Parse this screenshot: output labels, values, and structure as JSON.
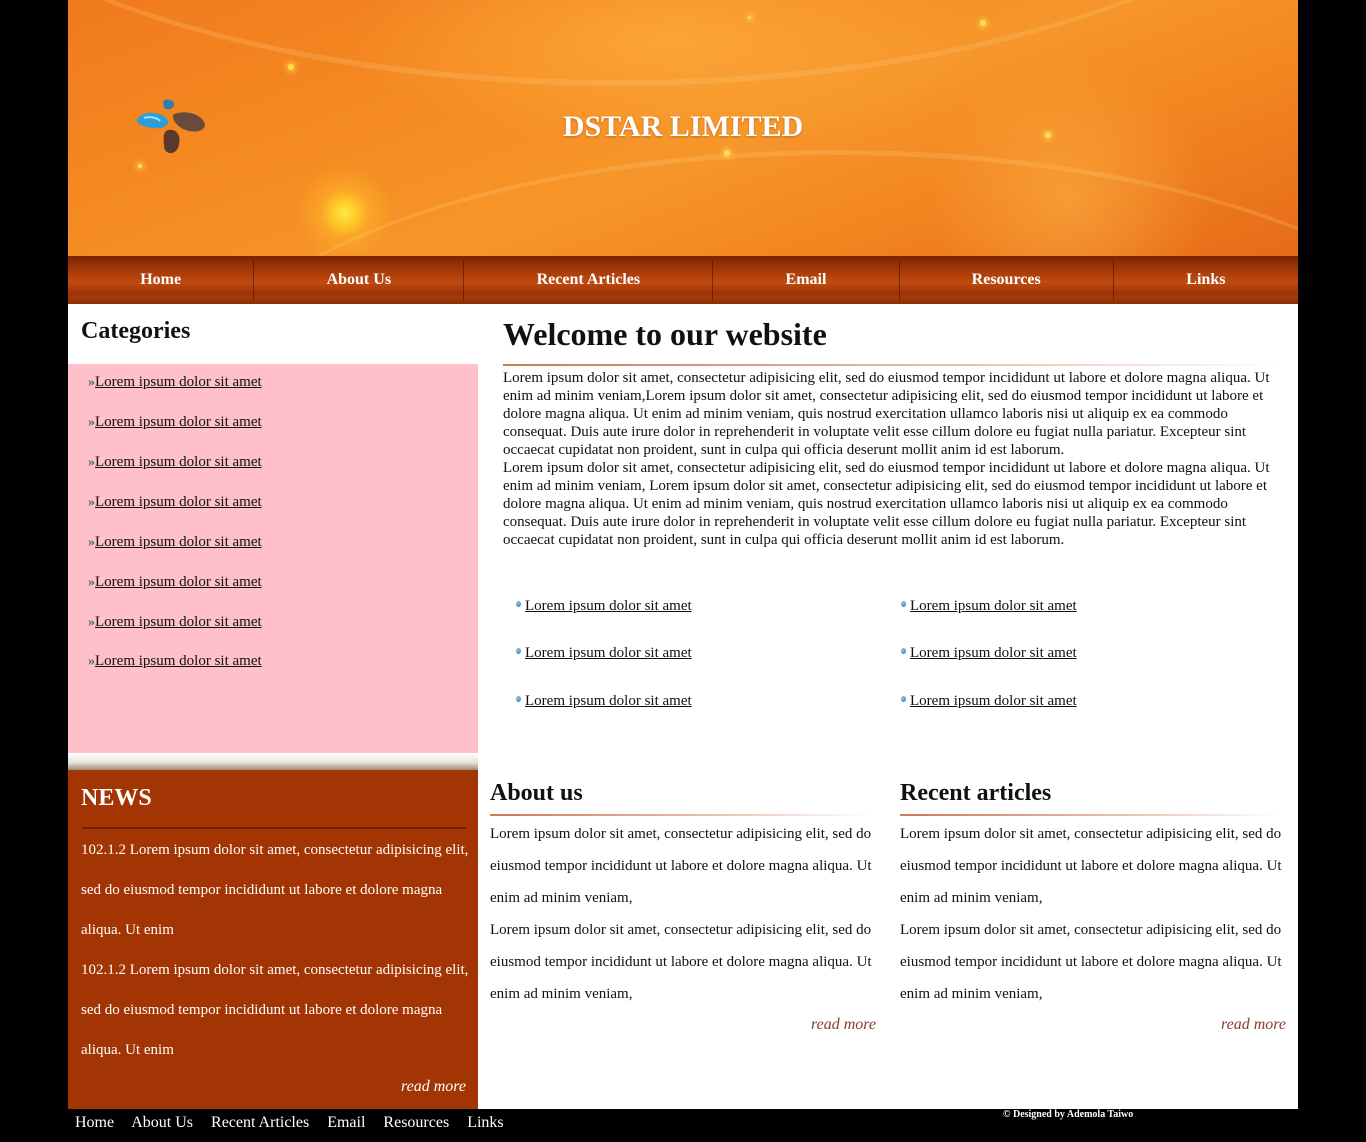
{
  "site": {
    "title": "DSTAR LIMITED",
    "logo": "dstar-logo"
  },
  "nav": {
    "items": [
      "Home",
      "About Us",
      "Recent Articles",
      "Email",
      "Resources",
      "Links"
    ]
  },
  "categories": {
    "title": "Categories",
    "items": [
      "Lorem ipsum dolor sit amet",
      "Lorem ipsum dolor sit amet",
      "Lorem ipsum dolor sit amet",
      "Lorem ipsum dolor sit amet",
      "Lorem ipsum dolor sit amet",
      "Lorem ipsum dolor sit amet",
      "Lorem ipsum dolor sit amet",
      "Lorem ipsum dolor sit amet"
    ],
    "arrow_icon": "double-arrow-icon"
  },
  "welcome": {
    "title": "Welcome to our website",
    "paragraph1": "Lorem ipsum dolor sit amet, consectetur adipisicing elit, sed do eiusmod tempor incididunt ut labore et dolore magna aliqua. Ut enim ad minim veniam,Lorem ipsum dolor sit amet, consectetur adipisicing elit, sed do eiusmod tempor incididunt ut labore et dolore magna aliqua. Ut enim ad minim veniam, quis nostrud exercitation ullamco laboris nisi ut aliquip ex ea commodo consequat. Duis aute irure dolor in reprehenderit in voluptate velit esse cillum dolore eu fugiat nulla pariatur. Excepteur sint occaecat cupidatat non proident, sunt in culpa qui officia deserunt mollit anim id est laborum.",
    "paragraph2": "Lorem ipsum dolor sit amet, consectetur adipisicing elit, sed do eiusmod tempor incididunt ut labore et dolore magna aliqua. Ut enim ad minim veniam, Lorem ipsum dolor sit amet, consectetur adipisicing elit, sed do eiusmod tempor incididunt ut labore et dolore magna aliqua. Ut enim ad minim veniam, quis nostrud exercitation ullamco laboris nisi ut aliquip ex ea commodo consequat. Duis aute irure dolor in reprehenderit in voluptate velit esse cillum dolore eu fugiat nulla pariatur. Excepteur sint occaecat cupidatat non proident, sunt in culpa qui officia deserunt mollit anim id est laborum.",
    "links": [
      "Lorem ipsum dolor sit amet",
      "Lorem ipsum dolor sit amet",
      "Lorem ipsum dolor sit amet",
      "Lorem ipsum dolor sit amet",
      "Lorem ipsum dolor sit amet",
      "Lorem ipsum dolor sit amet"
    ],
    "bullet_icon": "bullet-dot-icon"
  },
  "news": {
    "title": "NEWS",
    "items": [
      "102.1.2 Lorem ipsum dolor sit amet, consectetur adipisicing elit, sed do eiusmod tempor incididunt ut labore et dolore magna aliqua. Ut enim",
      "102.1.2 Lorem ipsum dolor sit amet, consectetur adipisicing elit, sed do eiusmod tempor incididunt ut labore et dolore magna aliqua. Ut enim"
    ],
    "read_more": "read more"
  },
  "about": {
    "title": "About us",
    "paragraphs": [
      "Lorem ipsum dolor sit amet, consectetur adipisicing elit, sed do eiusmod tempor incididunt ut labore et dolore magna aliqua. Ut enim ad minim veniam,",
      "Lorem ipsum dolor sit amet, consectetur adipisicing elit, sed do eiusmod tempor incididunt ut labore et dolore magna aliqua. Ut enim ad minim veniam,"
    ],
    "read_more": "read more"
  },
  "recent": {
    "title": "Recent articles",
    "paragraphs": [
      "Lorem ipsum dolor sit amet, consectetur adipisicing elit, sed do eiusmod tempor incididunt ut labore et dolore magna aliqua. Ut enim ad minim veniam,",
      "Lorem ipsum dolor sit amet, consectetur adipisicing elit, sed do eiusmod tempor incididunt ut labore et dolore magna aliqua. Ut enim ad minim veniam,"
    ],
    "read_more": "read more"
  },
  "footer": {
    "nav": [
      "Home",
      "About Us",
      "Recent Articles",
      "Email",
      "Resources",
      "Links"
    ],
    "credit": "© Designed by Ademola Taiwo"
  },
  "colors": {
    "nav_bg": "#a53a08",
    "news_bg": "#a23503",
    "categories_bg": "#ffc0cb",
    "read_more_link": "#8a3a30"
  }
}
